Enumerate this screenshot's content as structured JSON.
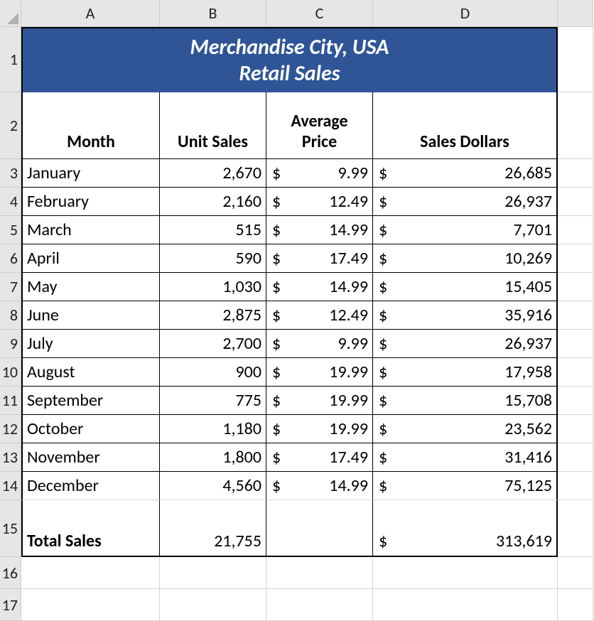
{
  "columns": [
    "A",
    "B",
    "C",
    "D"
  ],
  "row_labels": [
    "1",
    "2",
    "3",
    "4",
    "5",
    "6",
    "7",
    "8",
    "9",
    "10",
    "11",
    "12",
    "13",
    "14",
    "15",
    "16",
    "17"
  ],
  "title_line1": "Merchandise City, USA",
  "title_line2": "Retail Sales",
  "headers": {
    "month": "Month",
    "unit_sales": "Unit Sales",
    "avg_price": "Average\nPrice",
    "sales_dollars": "Sales Dollars"
  },
  "currency_symbol": "$",
  "rows": [
    {
      "month": "January",
      "unit_sales": "2,670",
      "avg_price": "9.99",
      "sales_dollars": "26,685"
    },
    {
      "month": "February",
      "unit_sales": "2,160",
      "avg_price": "12.49",
      "sales_dollars": "26,937"
    },
    {
      "month": "March",
      "unit_sales": "515",
      "avg_price": "14.99",
      "sales_dollars": "7,701"
    },
    {
      "month": "April",
      "unit_sales": "590",
      "avg_price": "17.49",
      "sales_dollars": "10,269"
    },
    {
      "month": "May",
      "unit_sales": "1,030",
      "avg_price": "14.99",
      "sales_dollars": "15,405"
    },
    {
      "month": "June",
      "unit_sales": "2,875",
      "avg_price": "12.49",
      "sales_dollars": "35,916"
    },
    {
      "month": "July",
      "unit_sales": "2,700",
      "avg_price": "9.99",
      "sales_dollars": "26,937"
    },
    {
      "month": "August",
      "unit_sales": "900",
      "avg_price": "19.99",
      "sales_dollars": "17,958"
    },
    {
      "month": "September",
      "unit_sales": "775",
      "avg_price": "19.99",
      "sales_dollars": "15,708"
    },
    {
      "month": "October",
      "unit_sales": "1,180",
      "avg_price": "19.99",
      "sales_dollars": "23,562"
    },
    {
      "month": "November",
      "unit_sales": "1,800",
      "avg_price": "17.49",
      "sales_dollars": "31,416"
    },
    {
      "month": "December",
      "unit_sales": "4,560",
      "avg_price": "14.99",
      "sales_dollars": "75,125"
    }
  ],
  "totals": {
    "label": "Total Sales",
    "unit_sales": "21,755",
    "avg_price": "",
    "sales_dollars": "313,619"
  },
  "colors": {
    "header_bg": "#e6e6e6",
    "title_bg": "#2F5597",
    "grid": "#d4d4d4"
  }
}
